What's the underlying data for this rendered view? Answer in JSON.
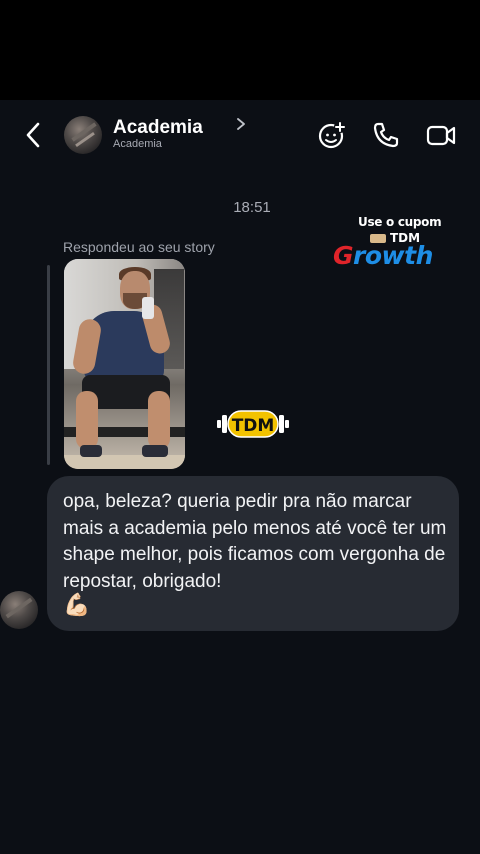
{
  "header": {
    "title": "Academia",
    "subtitle": "Academia",
    "icons": [
      "back-arrow-icon",
      "chevron-right-icon",
      "effects-icon",
      "phone-icon",
      "video-camera-icon"
    ]
  },
  "conversation": {
    "timestamp": "18:51",
    "story_reply_label": "Respondeu ao seu story",
    "message_text": "opa, beleza? queria pedir pra não marcar mais a academia pelo menos até você ter um shape melhor, pois ficamos com vergonha de repostar, obrigado!",
    "message_emoji": "💪🏻"
  },
  "overlay": {
    "promo_line1": "Use o cupom",
    "promo_code": "TDM",
    "brand_initial": "G",
    "brand_rest": "rowth",
    "watermark": "TDM"
  },
  "colors": {
    "background": "#0c0f15",
    "bubble": "#272b33",
    "brand_red": "#e0242a",
    "brand_blue": "#1e8ee6",
    "watermark_yellow": "#f2c200"
  }
}
